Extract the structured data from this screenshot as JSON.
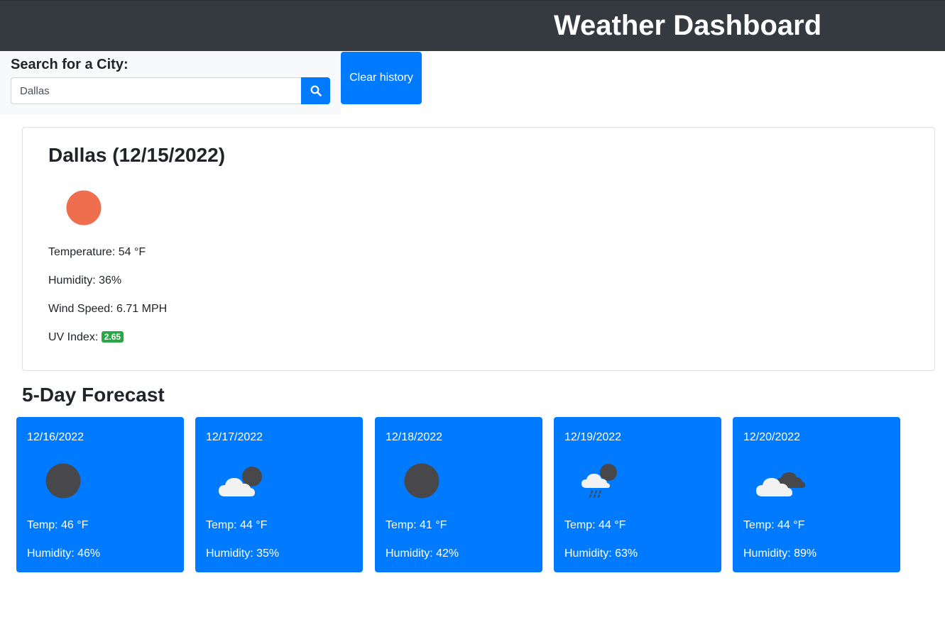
{
  "header": {
    "title": "Weather Dashboard"
  },
  "search": {
    "label": "Search for a City:",
    "value": "Dallas",
    "button_icon": "search-icon",
    "clear_label": "Clear history"
  },
  "current": {
    "title": "Dallas (12/15/2022)",
    "icon": "clear-sky-sun-icon",
    "temperature": "Temperature: 54 °F",
    "humidity": "Humidity: 36%",
    "wind": "Wind Speed: 6.71 MPH",
    "uv_label": "UV Index: ",
    "uv_value": "2.65"
  },
  "forecast": {
    "heading": "5-Day Forecast",
    "days": [
      {
        "date": "12/16/2022",
        "icon": "clear-night-moon-icon",
        "temp": "Temp: 46 °F",
        "humidity": "Humidity: 46%"
      },
      {
        "date": "12/17/2022",
        "icon": "few-clouds-night-icon",
        "temp": "Temp: 44 °F",
        "humidity": "Humidity: 35%"
      },
      {
        "date": "12/18/2022",
        "icon": "clear-night-moon-icon",
        "temp": "Temp: 41 °F",
        "humidity": "Humidity: 42%"
      },
      {
        "date": "12/19/2022",
        "icon": "rain-night-icon",
        "temp": "Temp: 44 °F",
        "humidity": "Humidity: 63%"
      },
      {
        "date": "12/20/2022",
        "icon": "broken-clouds-icon",
        "temp": "Temp: 44 °F",
        "humidity": "Humidity: 89%"
      }
    ]
  },
  "colors": {
    "header_bg": "#343a40",
    "primary": "#007bff",
    "uv_badge": "#28a745",
    "sun": "#ee6e4d",
    "moon": "#48484a"
  }
}
